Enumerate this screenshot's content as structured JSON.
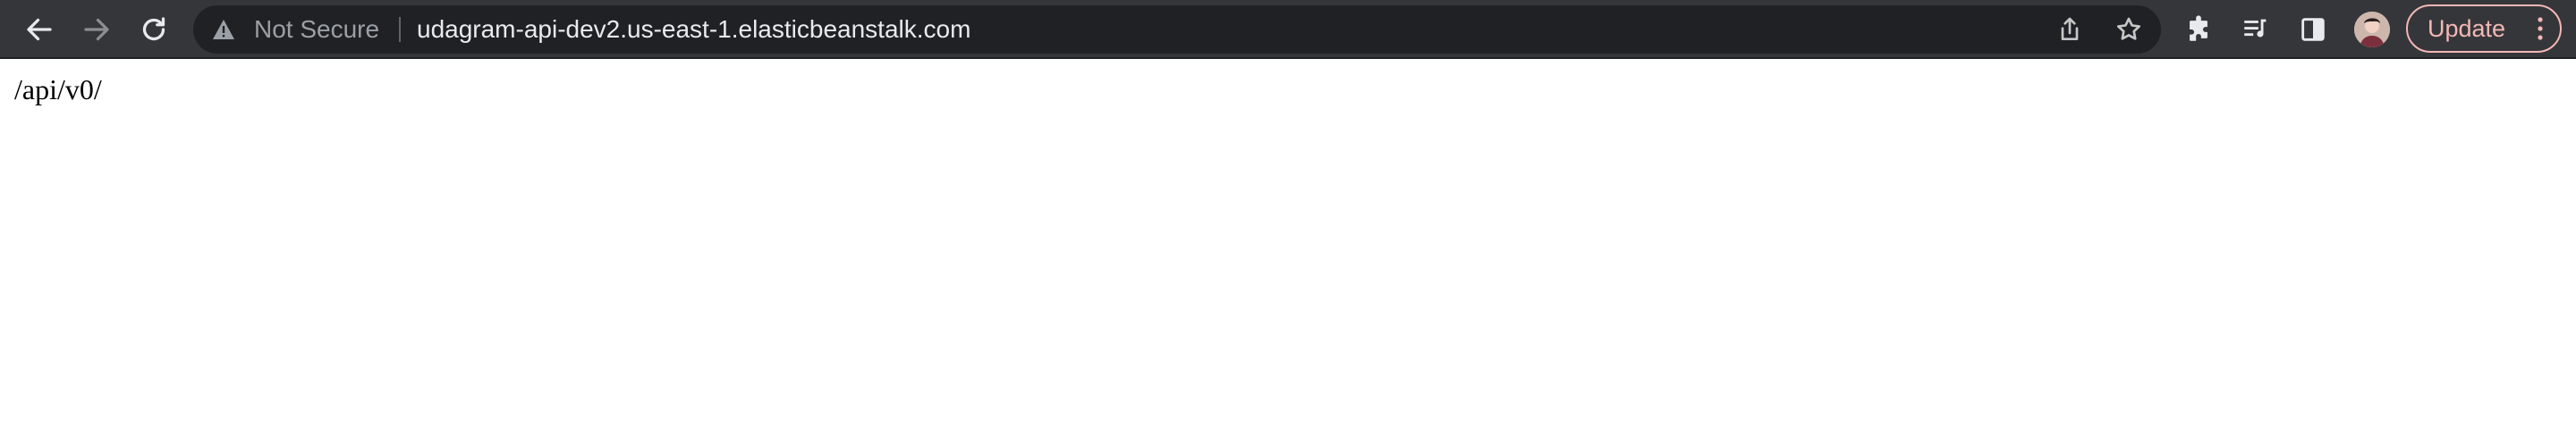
{
  "browser": {
    "toolbar": {
      "back_icon": "arrow-left-icon",
      "forward_icon": "arrow-right-icon",
      "reload_icon": "reload-icon"
    },
    "omnibox": {
      "security_icon": "warning-triangle-icon",
      "security_label": "Not Secure",
      "url": "udagram-api-dev2.us-east-1.elasticbeanstalk.com",
      "share_icon": "share-icon",
      "bookmark_icon": "star-icon"
    },
    "extensions_icon": "puzzle-icon",
    "media_icon": "media-queue-icon",
    "side_panel_icon": "side-panel-icon",
    "avatar": "profile-avatar",
    "update_button": {
      "label": "Update",
      "menu_icon": "kebab-menu-icon"
    }
  },
  "page": {
    "body_text": "/api/v0/"
  },
  "colors": {
    "toolbar_bg": "#35363a",
    "omnibox_bg": "#202124",
    "url_text": "#e8eaed",
    "security_text": "#9aa0a6",
    "update_accent": "#f2b8b5",
    "page_bg": "#ffffff"
  }
}
